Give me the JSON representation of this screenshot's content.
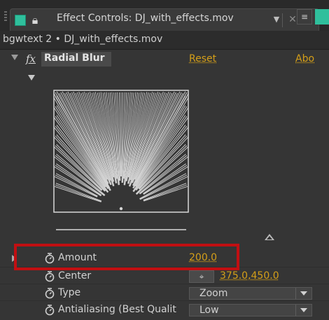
{
  "tab": {
    "title": "Effect Controls: DJ_with_effects.mov",
    "dropdown_icon": "chevron-down",
    "close_icon": "close",
    "lock_icon": "lock",
    "panel_menu_icon": "panel-menu"
  },
  "subheader": {
    "text": "bgwtext 2 • DJ_with_effects.mov"
  },
  "effect": {
    "fx_label": "fx",
    "name": "Radial Blur",
    "reset_label": "Reset",
    "about_label": "Abo"
  },
  "properties": [
    {
      "label": "Amount",
      "value": "200.0"
    },
    {
      "label": "Center",
      "value": "375.0,450.0"
    },
    {
      "label": "Type",
      "value": "Zoom"
    },
    {
      "label": "Antialiasing (Best Qualit",
      "value": "Low"
    }
  ],
  "colors": {
    "value_link": "#d59f18",
    "label_swatch": "#2fbf9c",
    "highlight": "#c10f12"
  }
}
